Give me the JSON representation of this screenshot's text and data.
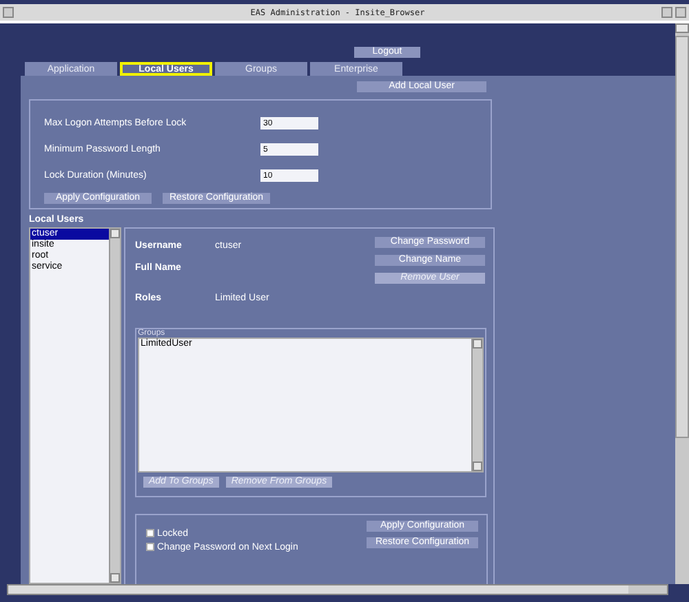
{
  "window": {
    "title": "EAS Administration - Insite_Browser"
  },
  "logout_button": "Logout",
  "tabs": [
    {
      "label": "Application",
      "selected": false
    },
    {
      "label": "Local Users",
      "selected": true
    },
    {
      "label": "Groups",
      "selected": false
    },
    {
      "label": "Enterprise",
      "selected": false
    }
  ],
  "add_local_user_button": "Add Local User",
  "settings": [
    {
      "label": "Max Logon Attempts Before Lock",
      "value": "30"
    },
    {
      "label": "Minimum Password Length",
      "value": "5"
    },
    {
      "label": "Lock Duration (Minutes)",
      "value": "10"
    }
  ],
  "settings_buttons": [
    "Apply Configuration",
    "Restore Configuration"
  ],
  "local_users": {
    "title": "Local Users",
    "items": [
      {
        "name": "ctuser",
        "selected": true
      },
      {
        "name": "insite",
        "selected": false
      },
      {
        "name": "root",
        "selected": false
      },
      {
        "name": "service",
        "selected": false
      }
    ]
  },
  "details": {
    "fields": [
      {
        "label": "Username",
        "value": "ctuser"
      },
      {
        "label": "Full Name"
      },
      {
        "label": "Roles",
        "value": "Limited User"
      }
    ],
    "buttons": [
      {
        "label": "Change Password",
        "disabled": false
      },
      {
        "label": "Change Name",
        "disabled": false
      },
      {
        "label": "Remove User",
        "disabled": true
      }
    ],
    "groups": {
      "title": "Groups",
      "items": [
        "LimitedUser"
      ],
      "buttons": [
        {
          "label": "Add To Groups",
          "disabled": true
        },
        {
          "label": "Remove From Groups",
          "disabled": true
        }
      ]
    },
    "options": [
      {
        "label": "Locked",
        "checked": false
      },
      {
        "label": "Change Password on Next Login",
        "checked": false
      }
    ],
    "option_buttons": [
      "Apply Configuration",
      "Restore Configuration"
    ]
  }
}
